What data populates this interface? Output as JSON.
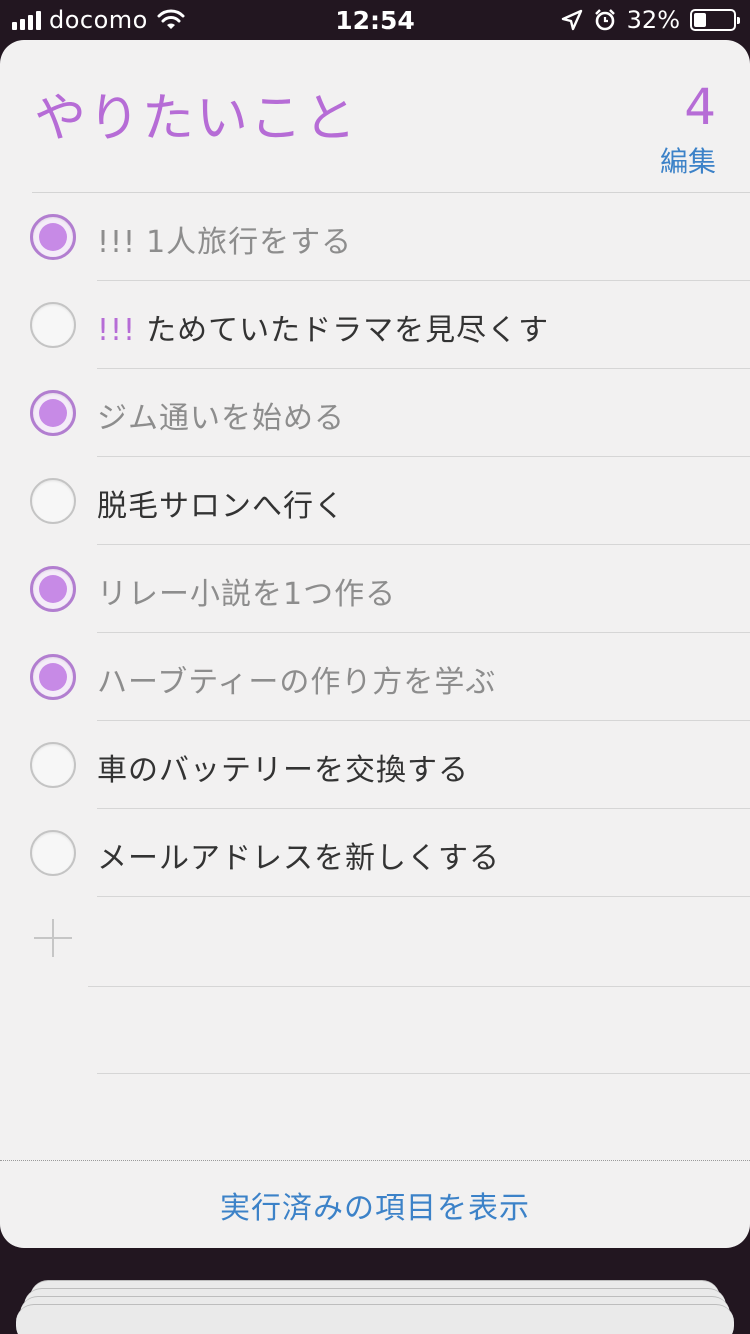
{
  "status_bar": {
    "carrier": "docomo",
    "time": "12:54",
    "battery": "32%",
    "battery_level": 0.32
  },
  "list": {
    "title": "やりたいこと",
    "count": "4",
    "edit_label": "編集",
    "items": [
      {
        "priority": "!!!",
        "text": "1人旅行をする",
        "completed": true
      },
      {
        "priority": "!!!",
        "text": "ためていたドラマを見尽くす",
        "completed": false
      },
      {
        "priority": "",
        "text": "ジム通いを始める",
        "completed": true
      },
      {
        "priority": "",
        "text": "脱毛サロンへ行く",
        "completed": false
      },
      {
        "priority": "",
        "text": "リレー小説を1つ作る",
        "completed": true
      },
      {
        "priority": "",
        "text": "ハーブティーの作り方を学ぶ",
        "completed": true
      },
      {
        "priority": "",
        "text": "車のバッテリーを交換する",
        "completed": false
      },
      {
        "priority": "",
        "text": "メールアドレスを新しくする",
        "completed": false
      }
    ],
    "show_completed_label": "実行済みの項目を表示"
  },
  "colors": {
    "accent": "#b66cd6",
    "link": "#3c82c8"
  },
  "icons": [
    "signal-bars-icon",
    "wifi-icon",
    "location-arrow-icon",
    "alarm-clock-icon",
    "battery-icon",
    "add-plus-icon"
  ]
}
